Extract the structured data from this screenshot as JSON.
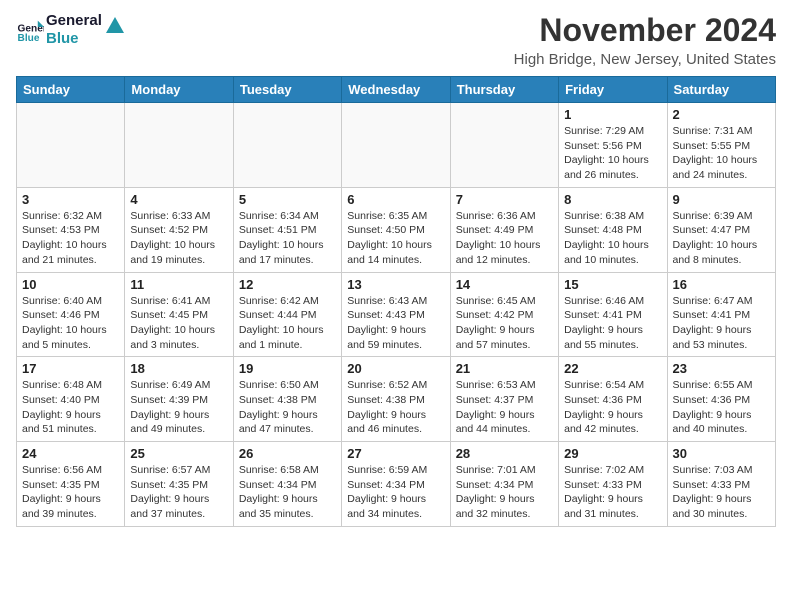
{
  "header": {
    "logo_line1": "General",
    "logo_line2": "Blue",
    "month_title": "November 2024",
    "location": "High Bridge, New Jersey, United States"
  },
  "days_of_week": [
    "Sunday",
    "Monday",
    "Tuesday",
    "Wednesday",
    "Thursday",
    "Friday",
    "Saturday"
  ],
  "weeks": [
    [
      {
        "day": "",
        "info": "",
        "empty": true
      },
      {
        "day": "",
        "info": "",
        "empty": true
      },
      {
        "day": "",
        "info": "",
        "empty": true
      },
      {
        "day": "",
        "info": "",
        "empty": true
      },
      {
        "day": "",
        "info": "",
        "empty": true
      },
      {
        "day": "1",
        "info": "Sunrise: 7:29 AM\nSunset: 5:56 PM\nDaylight: 10 hours\nand 26 minutes."
      },
      {
        "day": "2",
        "info": "Sunrise: 7:31 AM\nSunset: 5:55 PM\nDaylight: 10 hours\nand 24 minutes."
      }
    ],
    [
      {
        "day": "3",
        "info": "Sunrise: 6:32 AM\nSunset: 4:53 PM\nDaylight: 10 hours\nand 21 minutes."
      },
      {
        "day": "4",
        "info": "Sunrise: 6:33 AM\nSunset: 4:52 PM\nDaylight: 10 hours\nand 19 minutes."
      },
      {
        "day": "5",
        "info": "Sunrise: 6:34 AM\nSunset: 4:51 PM\nDaylight: 10 hours\nand 17 minutes."
      },
      {
        "day": "6",
        "info": "Sunrise: 6:35 AM\nSunset: 4:50 PM\nDaylight: 10 hours\nand 14 minutes."
      },
      {
        "day": "7",
        "info": "Sunrise: 6:36 AM\nSunset: 4:49 PM\nDaylight: 10 hours\nand 12 minutes."
      },
      {
        "day": "8",
        "info": "Sunrise: 6:38 AM\nSunset: 4:48 PM\nDaylight: 10 hours\nand 10 minutes."
      },
      {
        "day": "9",
        "info": "Sunrise: 6:39 AM\nSunset: 4:47 PM\nDaylight: 10 hours\nand 8 minutes."
      }
    ],
    [
      {
        "day": "10",
        "info": "Sunrise: 6:40 AM\nSunset: 4:46 PM\nDaylight: 10 hours\nand 5 minutes."
      },
      {
        "day": "11",
        "info": "Sunrise: 6:41 AM\nSunset: 4:45 PM\nDaylight: 10 hours\nand 3 minutes."
      },
      {
        "day": "12",
        "info": "Sunrise: 6:42 AM\nSunset: 4:44 PM\nDaylight: 10 hours\nand 1 minute."
      },
      {
        "day": "13",
        "info": "Sunrise: 6:43 AM\nSunset: 4:43 PM\nDaylight: 9 hours\nand 59 minutes."
      },
      {
        "day": "14",
        "info": "Sunrise: 6:45 AM\nSunset: 4:42 PM\nDaylight: 9 hours\nand 57 minutes."
      },
      {
        "day": "15",
        "info": "Sunrise: 6:46 AM\nSunset: 4:41 PM\nDaylight: 9 hours\nand 55 minutes."
      },
      {
        "day": "16",
        "info": "Sunrise: 6:47 AM\nSunset: 4:41 PM\nDaylight: 9 hours\nand 53 minutes."
      }
    ],
    [
      {
        "day": "17",
        "info": "Sunrise: 6:48 AM\nSunset: 4:40 PM\nDaylight: 9 hours\nand 51 minutes."
      },
      {
        "day": "18",
        "info": "Sunrise: 6:49 AM\nSunset: 4:39 PM\nDaylight: 9 hours\nand 49 minutes."
      },
      {
        "day": "19",
        "info": "Sunrise: 6:50 AM\nSunset: 4:38 PM\nDaylight: 9 hours\nand 47 minutes."
      },
      {
        "day": "20",
        "info": "Sunrise: 6:52 AM\nSunset: 4:38 PM\nDaylight: 9 hours\nand 46 minutes."
      },
      {
        "day": "21",
        "info": "Sunrise: 6:53 AM\nSunset: 4:37 PM\nDaylight: 9 hours\nand 44 minutes."
      },
      {
        "day": "22",
        "info": "Sunrise: 6:54 AM\nSunset: 4:36 PM\nDaylight: 9 hours\nand 42 minutes."
      },
      {
        "day": "23",
        "info": "Sunrise: 6:55 AM\nSunset: 4:36 PM\nDaylight: 9 hours\nand 40 minutes."
      }
    ],
    [
      {
        "day": "24",
        "info": "Sunrise: 6:56 AM\nSunset: 4:35 PM\nDaylight: 9 hours\nand 39 minutes."
      },
      {
        "day": "25",
        "info": "Sunrise: 6:57 AM\nSunset: 4:35 PM\nDaylight: 9 hours\nand 37 minutes."
      },
      {
        "day": "26",
        "info": "Sunrise: 6:58 AM\nSunset: 4:34 PM\nDaylight: 9 hours\nand 35 minutes."
      },
      {
        "day": "27",
        "info": "Sunrise: 6:59 AM\nSunset: 4:34 PM\nDaylight: 9 hours\nand 34 minutes."
      },
      {
        "day": "28",
        "info": "Sunrise: 7:01 AM\nSunset: 4:34 PM\nDaylight: 9 hours\nand 32 minutes."
      },
      {
        "day": "29",
        "info": "Sunrise: 7:02 AM\nSunset: 4:33 PM\nDaylight: 9 hours\nand 31 minutes."
      },
      {
        "day": "30",
        "info": "Sunrise: 7:03 AM\nSunset: 4:33 PM\nDaylight: 9 hours\nand 30 minutes."
      }
    ]
  ]
}
